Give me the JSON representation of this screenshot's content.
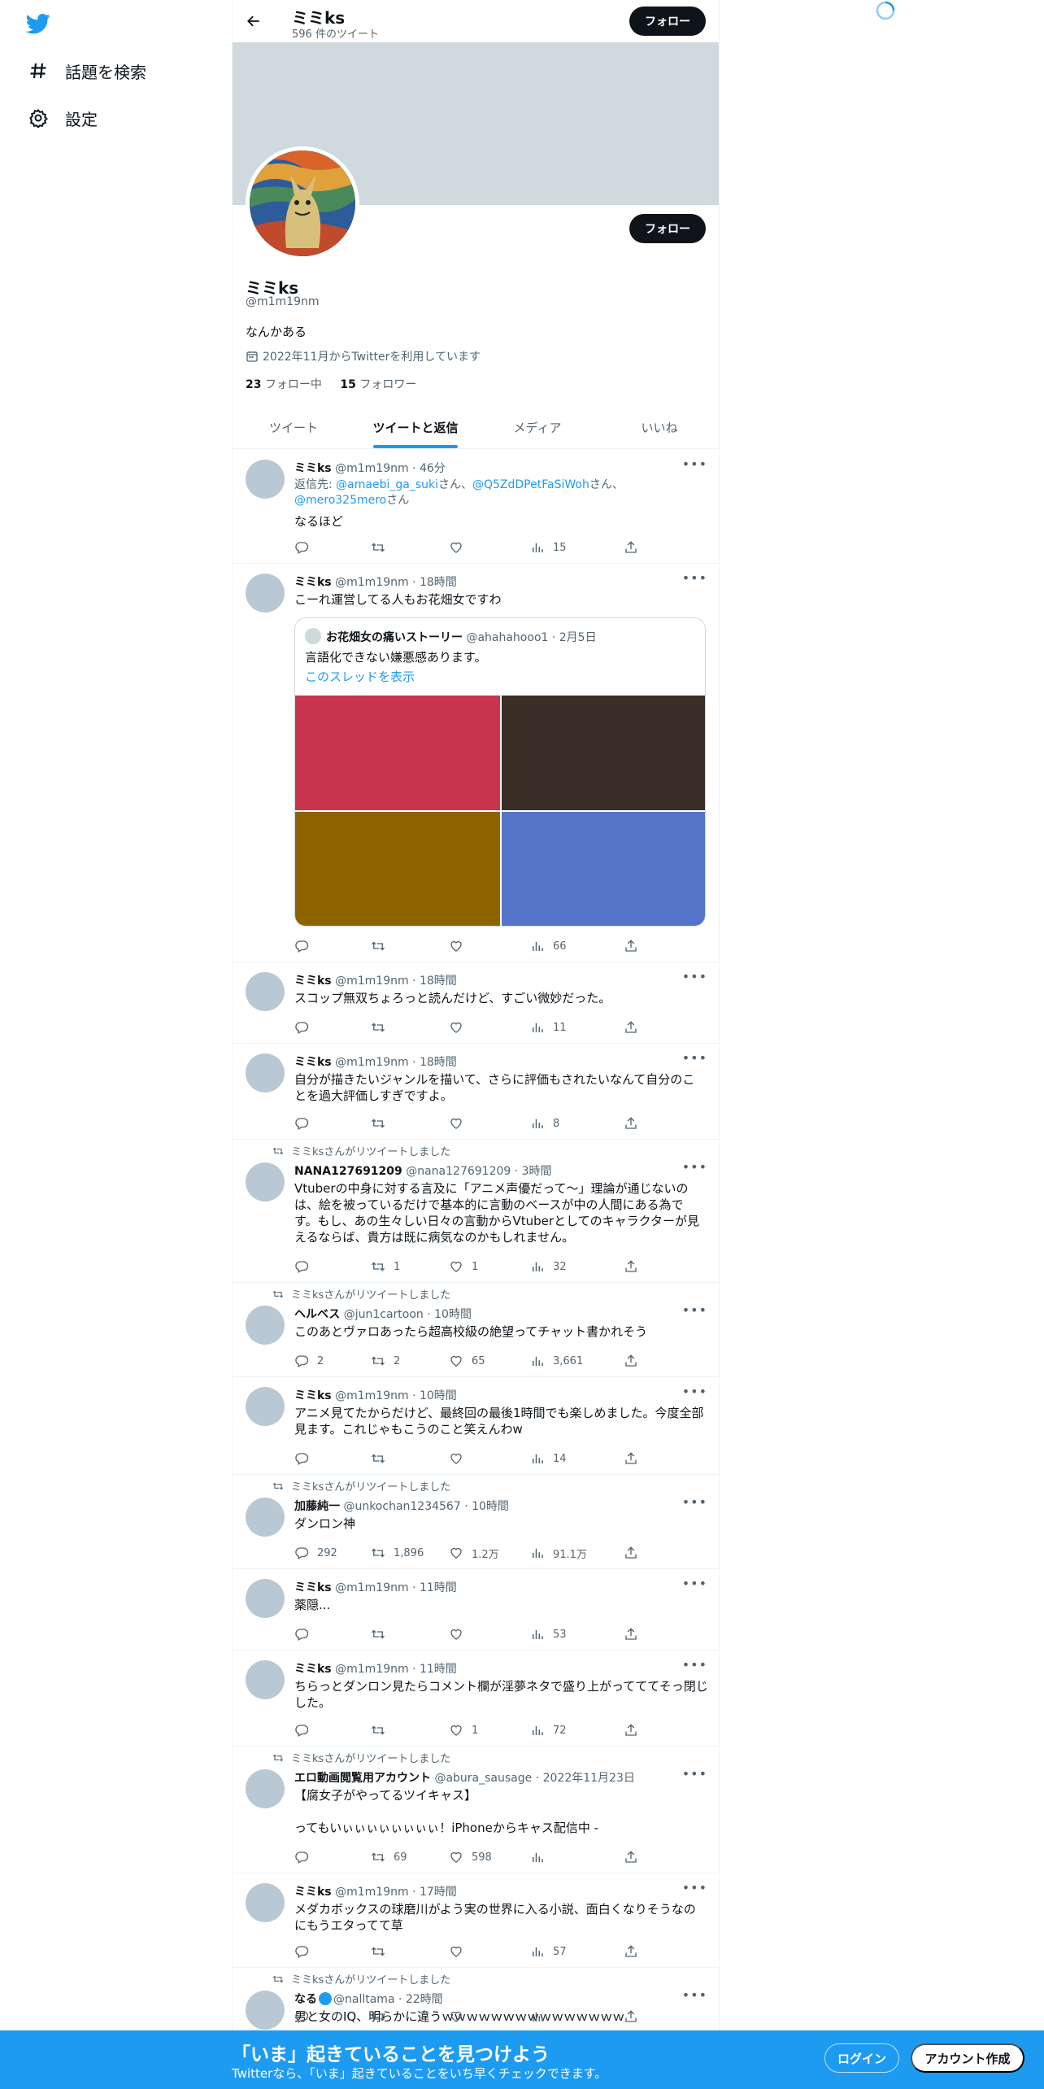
{
  "nav": {
    "explore_label": "話題を検索",
    "settings_label": "設定"
  },
  "header": {
    "title": "ミミks",
    "tweet_count": "596 件のツイート",
    "follow_label": "フォロー"
  },
  "profile": {
    "name": "ミミks",
    "handle": "@m1m19nm",
    "bio": "なんかある",
    "joined": "2022年11月からTwitterを利用しています",
    "following_count": "23",
    "following_label": "フォロー中",
    "followers_count": "15",
    "followers_label": "フォロワー",
    "follow_label": "フォロー"
  },
  "tabs": [
    {
      "label": "ツイート"
    },
    {
      "label": "ツイートと返信"
    },
    {
      "label": "メディア"
    },
    {
      "label": "いいね"
    }
  ],
  "tweets": [
    {
      "name": "ミミks",
      "handle_time": "@m1m19nm · 46分",
      "reply_prefix": "返信先: ",
      "reply_to": "@amaebi_ga_suki",
      "reply_sep1": "さん、",
      "reply_to2": "@Q5ZdDPetFaSiWoh",
      "reply_sep2": "さん、",
      "reply_to3": "@mero325mero",
      "reply_suffix": "さん",
      "text": "なるほど",
      "reply": "",
      "retweet": "",
      "like": "",
      "views": "15"
    },
    {
      "name": "ミミks",
      "handle_time": "@m1m19nm · 18時間",
      "text": "こーれ運営してる人もお花畑女ですわ",
      "quote": {
        "name": "お花畑女の痛いストーリー",
        "handle_time": "@ahahahooo1 · 2月5日",
        "text": "言語化できない嫌悪感あります。",
        "link": "このスレッドを表示",
        "image_colors": [
          "#c8344c",
          "#3a2e26",
          "#8d6300",
          "#5574c9"
        ]
      },
      "reply": "",
      "retweet": "",
      "like": "",
      "views": "66"
    },
    {
      "name": "ミミks",
      "handle_time": "@m1m19nm · 18時間",
      "text": "スコップ無双ちょろっと読んだけど、すごい微妙だった。",
      "reply": "",
      "retweet": "",
      "like": "",
      "views": "11"
    },
    {
      "name": "ミミks",
      "handle_time": "@m1m19nm · 18時間",
      "text": "自分が描きたいジャンルを描いて、さらに評価もされたいなんて自分のこ\nとを過大評価しすぎですよ。",
      "reply": "",
      "retweet": "",
      "like": "",
      "views": "8"
    },
    {
      "retweeted_by": "ミミksさんがリツイートしました",
      "name": "NANA127691209",
      "handle_time": "@nana127691209 · 3時間",
      "text": "Vtuberの中身に対する言及に「アニメ声優だって～」理論が通じないの\nは、絵を被っているだけで基本的に言動のベースが中の人間にある為で\nす。もし、あの生々しい日々の言動からVtuberとしてのキャラクターが見\nえるならば、貴方は既に病気なのかもしれません。",
      "reply": "",
      "retweet": "1",
      "like": "1",
      "views": "32"
    },
    {
      "retweeted_by": "ミミksさんがリツイートしました",
      "name": "ヘルベス",
      "handle_time": "@jun1cartoon · 10時間",
      "text": "このあとヴァロあったら超高校級の絶望ってチャット書かれそう",
      "reply": "2",
      "retweet": "2",
      "like": "65",
      "views": "3,661"
    },
    {
      "name": "ミミks",
      "handle_time": "@m1m19nm · 10時間",
      "text": "アニメ見てたからだけど、最終回の最後1時間でも楽しめました。今度全部\n見ます。これじゃもこうのこと笑えんわw",
      "reply": "",
      "retweet": "",
      "like": "",
      "views": "14"
    },
    {
      "retweeted_by": "ミミksさんがリツイートしました",
      "name": "加藤純一",
      "handle_time": "@unkochan1234567 · 10時間",
      "text": "ダンロン神",
      "reply": "292",
      "retweet": "1,896",
      "like": "1.2万",
      "views": "91.1万"
    },
    {
      "name": "ミミks",
      "handle_time": "@m1m19nm · 11時間",
      "text": "薬隠...",
      "reply": "",
      "retweet": "",
      "like": "",
      "views": "53"
    },
    {
      "name": "ミミks",
      "handle_time": "@m1m19nm · 11時間",
      "text": "ちらっとダンロン見たらコメント欄が淫夢ネタで盛り上がってててそっ閉じ\nした。",
      "reply": "",
      "retweet": "",
      "like": "1",
      "views": "72"
    },
    {
      "retweeted_by": "ミミksさんがリツイートしました",
      "name": "エロ動画閲覧用アカウント",
      "handle_time": "@abura_sausage · 2022年11月23日",
      "text": "【腐女子がやってるツイキャス】\n\nってもいぃぃぃぃぃぃぃぃ！iPhoneからキャス配信中 -",
      "reply": "",
      "retweet": "69",
      "like": "598",
      "views": ""
    },
    {
      "name": "ミミks",
      "handle_time": "@m1m19nm · 17時間",
      "text": "メダカボックスの球磨川がよう実の世界に入る小説、面白くなりそうなの\nにもうエタってて草",
      "reply": "",
      "retweet": "",
      "like": "",
      "views": "57"
    },
    {
      "retweeted_by": "ミミksさんがリツイートしました",
      "name": "なる",
      "handle_time": "@nalltama · 22時間",
      "text": "男と女のIQ、明らかに違うｗｗｗｗｗｗｗｗｗｗｗｗｗｗｗ",
      "reply": "",
      "retweet": "",
      "like": "",
      "views": ""
    }
  ],
  "bottom_bar": {
    "title": "「いま」起きていることを見つけよう",
    "subtitle": "Twitterなら、「いま」起きていることをいち早くチェックできます。",
    "login_label": "ログイン",
    "signup_label": "アカウント作成"
  },
  "colors": {
    "accent": "#1d9bf0",
    "banner": "#cfd9de",
    "text": "#0f1419",
    "muted": "#536471"
  }
}
